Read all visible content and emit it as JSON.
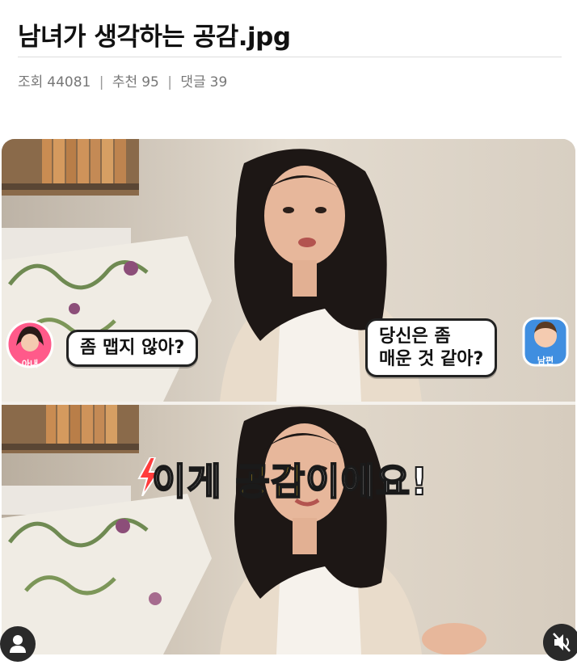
{
  "post": {
    "title": "남녀가 생각하는 공감.jpg",
    "views_label": "조회",
    "views": "44081",
    "recommend_label": "추천",
    "recommend": "95",
    "comments_label": "댓글",
    "comments": "39",
    "separator": "|"
  },
  "image": {
    "top_panel": {
      "wife_badge": "아내",
      "wife_line": "좀 맵지 않아?",
      "husband_line_1": "당신은 좀",
      "husband_line_2": "매운 것 같아?",
      "husband_badge": "남편"
    },
    "bottom_panel": {
      "caption_prefix": "이게 ",
      "caption_accent": "공감",
      "caption_suffix": "이에요!"
    }
  },
  "icons": {
    "user": "user-icon",
    "mute": "mute-icon",
    "spark": "lightning-icon"
  },
  "colors": {
    "caption_accent": "#ffd21f",
    "caption_fill": "#ffffff"
  }
}
